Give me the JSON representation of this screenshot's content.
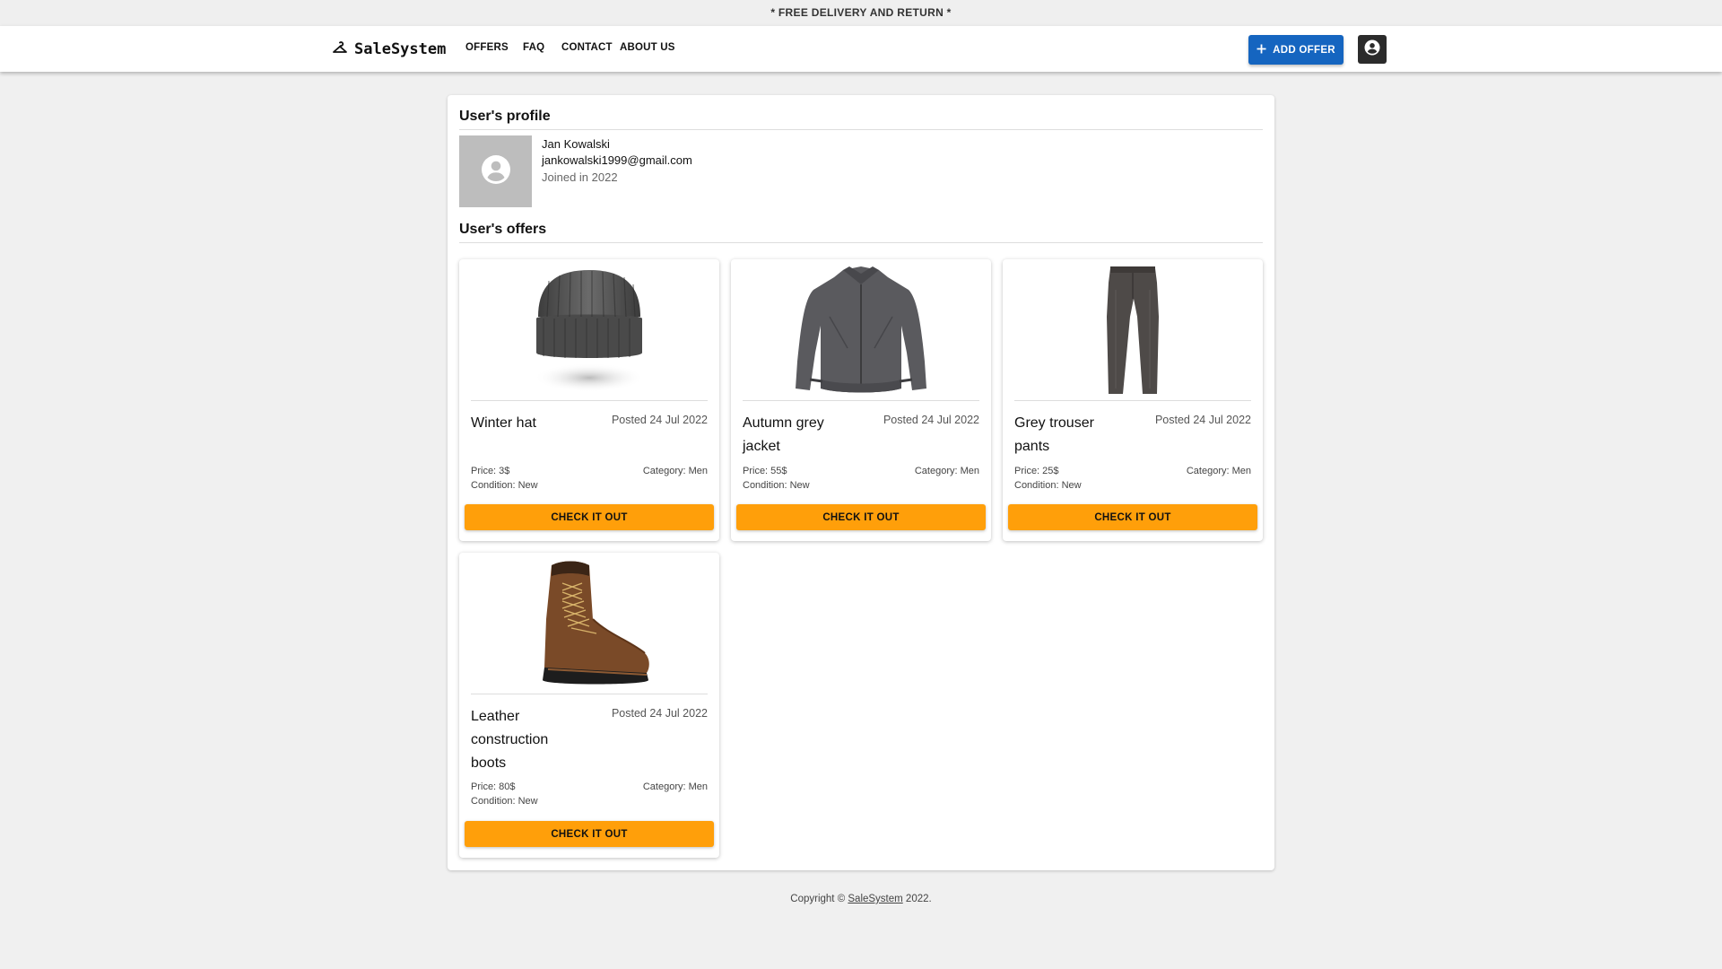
{
  "promo": {
    "text": "* FREE DELIVERY AND RETURN *"
  },
  "header": {
    "brand": "SaleSystem",
    "brand_icon": "hanger-icon",
    "nav": [
      "OFFERS",
      "FAQ",
      "CONTACT",
      "ABOUT US"
    ],
    "add_offer_label": "ADD OFFER",
    "account_icon": "account-circle-icon",
    "colors": {
      "primary": "#1565c0",
      "account": "#2b2b2b"
    }
  },
  "profile": {
    "title": "User's profile",
    "name": "Jan Kowalski",
    "email": "jankowalski1999@gmail.com",
    "joined": "Joined in 2022"
  },
  "offers": {
    "title": "User's offers",
    "accent": "#ff9f0a",
    "items": [
      {
        "title": "Winter hat",
        "posted": "Posted 24 Jul 2022",
        "price": "Price: 3$",
        "condition": "Condition: New",
        "category": "Category: Men",
        "cta": "CHECK IT OUT",
        "image": "beanie-hat"
      },
      {
        "title": "Autumn grey jacket",
        "posted": "Posted 24 Jul 2022",
        "price": "Price: 55$",
        "condition": "Condition: New",
        "category": "Category: Men",
        "cta": "CHECK IT OUT",
        "image": "grey-jacket"
      },
      {
        "title": "Grey trouser pants",
        "posted": "Posted 24 Jul 2022",
        "price": "Price: 25$",
        "condition": "Condition: New",
        "category": "Category: Men",
        "cta": "CHECK IT OUT",
        "image": "trousers"
      },
      {
        "title": "Leather construction boots",
        "posted": "Posted 24 Jul 2022",
        "price": "Price: 80$",
        "condition": "Condition: New",
        "category": "Category: Men",
        "cta": "CHECK IT OUT",
        "image": "leather-boot"
      }
    ]
  },
  "footer": {
    "prefix": "Copyright © ",
    "link": "SaleSystem",
    "suffix": " 2022."
  }
}
